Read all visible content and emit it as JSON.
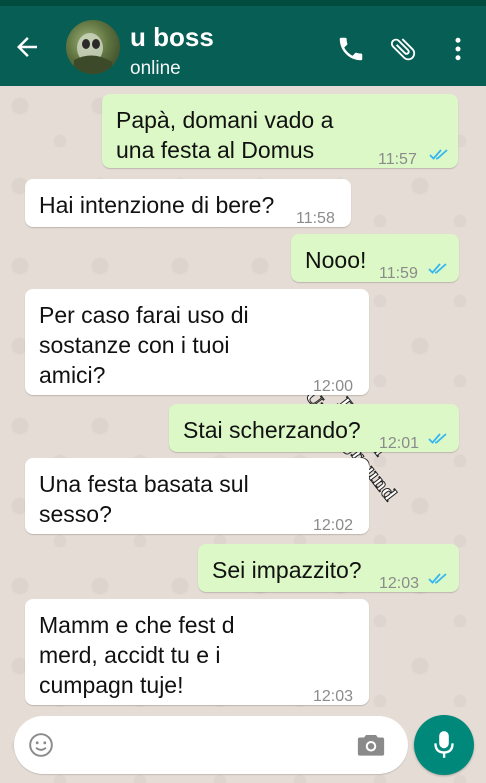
{
  "header": {
    "contact_name": "u boss",
    "status": "online"
  },
  "colors": {
    "header_bg": "#075E54",
    "outgoing_bubble": "#DCF8C6",
    "incoming_bubble": "#FFFFFF",
    "read_ticks": "#34B7F1",
    "mic_button": "#00897B"
  },
  "messages": [
    {
      "direction": "outgoing",
      "text": "Papà, domani vado a\nuna festa al Domus",
      "time": "11:57",
      "read": true
    },
    {
      "direction": "incoming",
      "text": "Hai intenzione di bere?",
      "time": "11:58"
    },
    {
      "direction": "outgoing",
      "text": "Nooo!",
      "time": "11:59",
      "read": true
    },
    {
      "direction": "incoming",
      "text": "Per caso farai uso di\nsostanze con i tuoi\namici?",
      "time": "12:00"
    },
    {
      "direction": "outgoing",
      "text": "Stai scherzando?",
      "time": "12:01",
      "read": true
    },
    {
      "direction": "incoming",
      "text": "Una festa basata sul\nsesso?",
      "time": "12:02"
    },
    {
      "direction": "outgoing",
      "text": "Sei impazzito?",
      "time": "12:03",
      "read": true
    },
    {
      "direction": "incoming",
      "text": "Mamm e che fest d\nmerd, accidt tu e i\ncumpagn tuje!",
      "time": "12:03"
    }
  ],
  "watermark": {
    "line1": "Foggia",
    "line2": "Underground"
  },
  "icons": {
    "back": "arrow-left-icon",
    "call": "phone-icon",
    "attach": "paperclip-icon",
    "menu": "more-vert-icon",
    "emoji": "emoji-icon",
    "camera": "camera-icon",
    "mic": "mic-icon",
    "ticks": "double-check-icon"
  }
}
